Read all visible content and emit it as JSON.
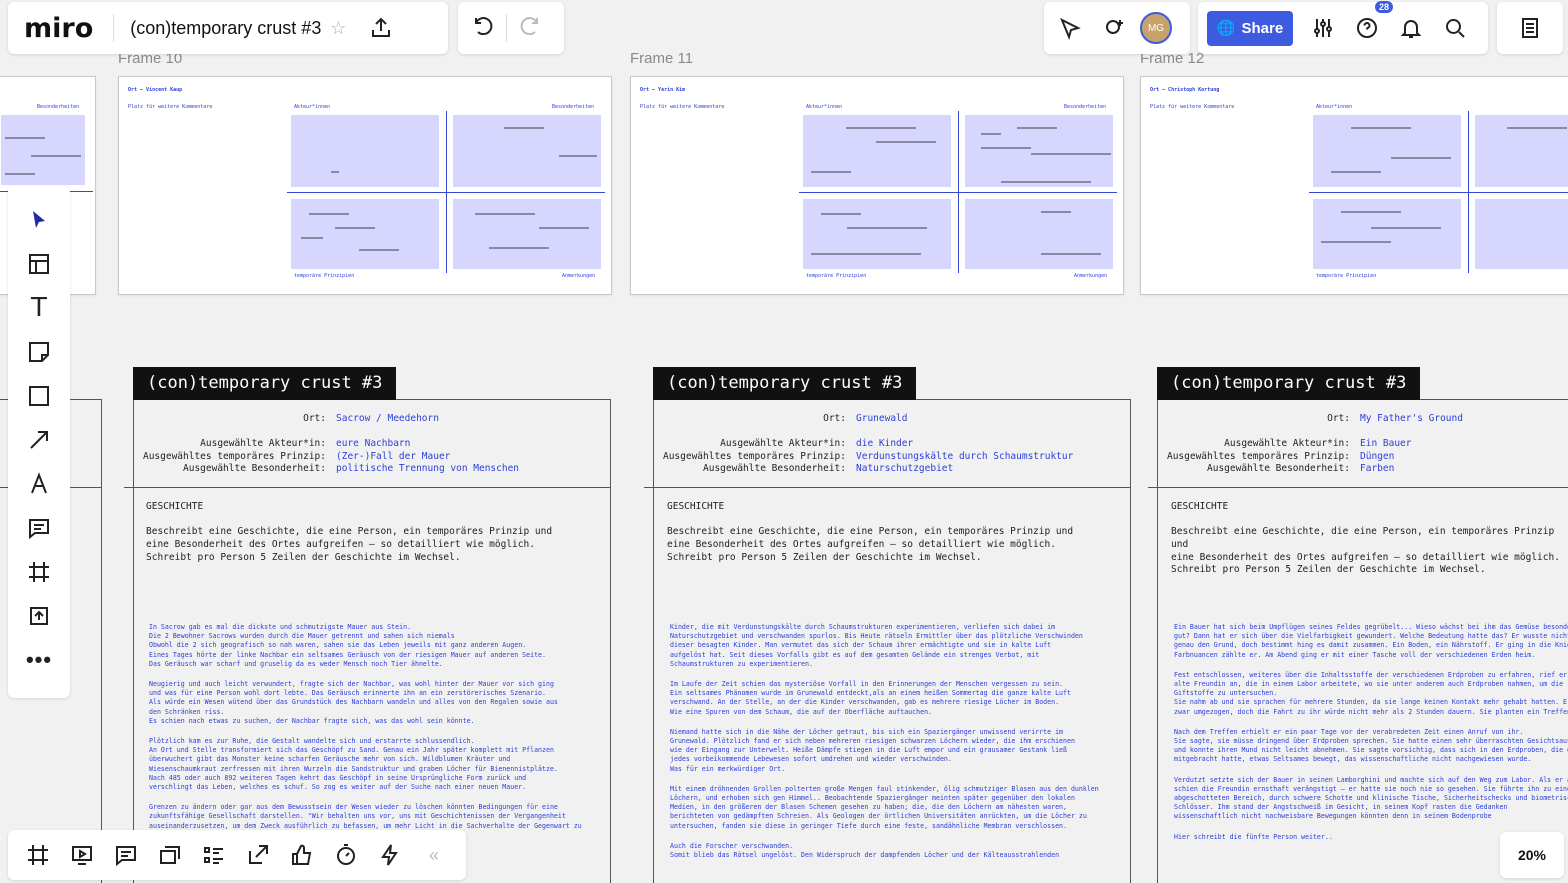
{
  "app": {
    "logo": "miro",
    "board_title": "(con)temporary crust #3",
    "share_label": "Share",
    "avatar_initials": "MG",
    "notifications_count": "28",
    "zoom": "20%",
    "accent": "#3c5be0"
  },
  "frames": [
    {
      "label": "Frame 10",
      "ort": "Ort – Vincent Kaup",
      "kommentare": "Platz für weitere Kommentare",
      "akteure": "Akteur*innen",
      "besonderheiten": "Besonderheiten",
      "prinzipien": "temporäre Prinzipien",
      "anmerkungen": "Anmerkungen"
    },
    {
      "label": "Frame 11",
      "ort": "Ort – Yerin Kim",
      "kommentare": "Platz für weitere Kommentare",
      "akteure": "Akteur*innen",
      "besonderheiten": "Besonderheiten",
      "prinzipien": "temporäre Prinzipien",
      "anmerkungen": "Anmerkungen"
    },
    {
      "label": "Frame 12",
      "ort": "Ort – Christoph Kortung",
      "kommentare": "Platz für weitere Kommentare",
      "akteure": "Akteur*innen",
      "besonderheiten": "Besonderheiten",
      "prinzipien": "temporäre Prinzipien",
      "anmerkungen": ""
    }
  ],
  "left_partial_frame": {
    "besonderheiten": "Besonderheiten"
  },
  "cards": [
    {
      "tag": "(con)temporary crust #3",
      "k_ort": "Ort:",
      "v_ort": "Sacrow / Meedehorn",
      "k_akteur": "Ausgewählte Akteur*in:",
      "v_akteur": "eure Nachbarn",
      "k_prinzip": "Ausgewähltes temporäres Prinzip:",
      "v_prinzip": "(Zer-)Fall der Mauer",
      "k_besonder": "Ausgewählte Besonderheit:",
      "v_besonder": "politische Trennung von Menschen",
      "geschichte": "GESCHICHTE",
      "instruction": "Beschreibt eine Geschichte, die eine Person, ein temporäres Prinzip und\neine Besonderheit des Ortes aufgreifen – so detailliert wie möglich.\nSchreibt pro Person 5 Zeilen der Geschichte im Wechsel.",
      "paragraphs": [
        "In Sacrow gab es mal die dickste und schmutzigste Mauer aus Stein.\nDie 2 Bewohner Sacrows wurden durch die Mauer getrennt und sahen sich niemals\nObwohl die 2 sich geografisch so nah waren, sahen sie das Leben jeweils mit ganz anderen Augen.\nEines Tages hörte der linke Nachbar ein seltsames Geräusch von der riesigen Mauer auf anderen Seite.\nDas Geräusch war scharf und gruselig da es weder Mensch noch Tier ähnelte.",
        "Neugierig und auch leicht verwundert, fragte sich der Nachbar, was wohl hinter der Mauer vor sich ging\nund was für eine Person wohl dort lebte. Das Geräusch erinnerte ihn an ein zerstörerisches Szenario.\nAls würde ein Wesen wütend über das Grundstück des Nachbarn wandeln und alles von den Regalen sowie aus\nden Schränken riss.\nEs schien nach etwas zu suchen, der Nachbar fragte sich, was das wohl sein könnte.",
        "Plötzlich kam es zur Ruhe, die Gestalt wandelte sich und erstarrte schlussendlich.\nAn Ort und Stelle transformiert sich das Geschöpf zu Sand. Genau ein Jahr später komplett mit Pflanzen\nüberwuchert gibt das Monster keine scharfen Geräusche mehr von sich. Wildblumen Kräuter und\nWiesenschaumkraut zerfressen mit ihren Wurzeln die Sandstruktur und graben Löcher für Bienennistplätze.\nNach 485 oder auch 892 weiteren Tagen kehrt das Geschöpf in seine Ursprüngliche Form zurück und\nverschlingt das Leben, welches es schuf. So zog es weiter auf der Suche nach einer neuen Mauer.",
        "Grenzen zu ändern oder gar aus dem Bewusstsein der Wesen wieder zu löschen könnten Bedingungen für eine\nzukunftsfähige Gesellschaft darstellen. \"Wir behalten uns vor, uns mit Geschichtenissen der Vergangenheit\nauseinanderzusetzen, um dem Zweck ausführlich zu befassen, um mehr Licht in die Sachverhalte der Gegenwart zu"
      ]
    },
    {
      "tag": "(con)temporary crust #3",
      "k_ort": "Ort:",
      "v_ort": "Grunewald",
      "k_akteur": "Ausgewählte Akteur*in:",
      "v_akteur": "die Kinder",
      "k_prinzip": "Ausgewähltes temporäres Prinzip:",
      "v_prinzip": "Verdunstungskälte durch Schaumstruktur",
      "k_besonder": "Ausgewählte Besonderheit:",
      "v_besonder": "Naturschutzgebiet",
      "geschichte": "GESCHICHTE",
      "instruction": "Beschreibt eine Geschichte, die eine Person, ein temporäres Prinzip und\neine Besonderheit des Ortes aufgreifen – so detailliert wie möglich.\nSchreibt pro Person 5 Zeilen der Geschichte im Wechsel.",
      "paragraphs": [
        "Kinder, die mit Verdunstungskälte durch Schaumstrukturen experimentieren, verliefen sich dabei im\nNaturschutzgebiet und verschwanden spurlos. Bis Heute rätseln Ermittler über das plötzliche Verschwinden\ndieser besagten Kinder. Man vermutet das sich der Schaum ihrer ermächtigte und sie in kalte Luft\naufgelöst hat. Seit dieses Vorfalls gibt es auf dem gesamten Gelände ein strenges Verbot, mit\nSchaumstrukturen zu experimentieren.",
        "Im Laufe der Zeit schien das mysteriöse Vorfall in den Erinnerungen der Menschen vergessen zu sein.\nEin seltsames Phänomen wurde im Grunewald entdeckt,als an einem heißen Sommertag die ganze kalte Luft\nverschwand. An der Stelle, an der die Kinder verschwanden, gab es mehrere riesige Löcher im Boden.\nWie eine Spuren von dem Schaum, die auf der Oberfläche auftauchen.",
        "Niemand hatte sich in die Nähe der Löcher getraut, bis sich ein Spaziergänger unwissend verirrte im\nGrunewald. Plötzlich fand er sich neben mehreren riesigen schwarzen Löchern wieder, die ihm erschienen\nwie der Eingang zur Unterwelt. Heiße Dämpfe stiegen in die Luft empor und ein grausamer Gestank ließ\njedes vorbeikommende Lebewesen sofort umdrehen und wieder verschwinden.\nWas für ein merkwürdiger Ort.",
        "Mit einem dröhnenden Grollen polterten große Mengen faul stinkender, ölig schmutziger Blasen aus den dunklen\nLöchern, und erhoben sich gen Himmel.. Beobachtende Spaziergänger meinten später gegenüber den lokalen\nMedien, in den größeren der Blasen Schemen gesehen zu haben; die, die den Löchern am nähesten waren,\nberichteten von gedämpften Schreien. Als Geologen der örtlichen Universitäten anrückten, um die Löcher zu\nuntersuchen, fanden sie diese in geringer Tiefe durch eine feste, sandähnliche Membran verschlossen.",
        "Auch die Forscher verschwanden.\nSomit blieb das Rätsel ungelöst. Den Widerspruch der dampfenden Löcher und der Kälteausstrahlenden"
      ]
    },
    {
      "tag": "(con)temporary crust #3",
      "k_ort": "Ort:",
      "v_ort": "My Father's Ground",
      "k_akteur": "Ausgewählte Akteur*in:",
      "v_akteur": "Ein Bauer",
      "k_prinzip": "Ausgewähltes temporäres Prinzip:",
      "v_prinzip": "Düngen",
      "k_besonder": "Ausgewählte Besonderheit:",
      "v_besonder": "Farben",
      "geschichte": "GESCHICHTE",
      "instruction": "Beschreibt eine Geschichte, die eine Person, ein temporäres Prinzip und\neine Besonderheit des Ortes aufgreifen – so detailliert wie möglich.\nSchreibt pro Person 5 Zeilen der Geschichte im Wechsel.",
      "paragraphs": [
        "Ein Bauer hat sich beim Umpflügen seines Feldes gegrübelt... Wieso wächst bei ihm das Gemüse besonders\ngut? Dann hat er sich über die Vielfarbigkeit gewundert. Welche Bedeutung hatte das? Er wusste nicht\ngenau den Grund, doch bestimmt hing es damit zusammen. Ein Boden, ein Nährstoff. Er ging in die Knie\nFarbnuancen zählte er. Am Abend ging er mit einer Tasche voll der verschiedenen Erden heim.",
        "Fest entschlossen, weiteres über die Inhaltsstoffe der verschiedenen Erdproben zu erfahren, rief er\nalte Freundin an, die in einem Labor arbeitete, wo sie unter anderem auch Erdproben nahmen, um die\nGiftstoffe zu untersuchen.\nSie nahm ab und sie sprachen für mehrere Stunden, da sie lange keinen Kontakt mehr gehabt hatten. Er\nzwar umgezogen, doch die Fahrt zu ihr würde nicht mehr als 2 Stunden dauern. Sie planten ein Treffen.",
        "Nach dem Treffen erhielt er ein paar Tage vor der verabredeten Zeit einen Anruf von ihr.\nSie sagte, sie müsse dringend über Erdproben sprechen. Sie hatte einen sehr überraschten Gesichtsausdruck\nund konnte ihren Mund nicht leicht abnehmen. Sie sagte vorsichtig, dass sich in den Erdproben, die er\nmitgebracht hatte, etwas Seltsames bewegt, das wissenschaftliche nicht nachgewiesen wurde.",
        "Verdutzt setzte sich der Bauer in seinen Lamborghini und machte sich auf den Weg zum Labor. Als er ankam\nschien die Freundin ernsthaft verängstigt – er hatte sie noch nie so gesehen. Sie führte ihn zu einem\nabgeschotteten Bereich, durch schwere Schotte und klinische Tische, Sicherheitschecks und biometrische\nSchlösser. Ihm stand der Angstschweiß im Gesicht, in seinem Kopf rasten die Gedanken\nwissenschaftlich nicht nachweisbare Bewegungen könnten denn in seinem Bodenprobe",
        "Hier schreibt die fünfte Person weiter.."
      ]
    }
  ],
  "left_tools": [
    "select-tool",
    "templates-tool",
    "text-tool",
    "sticky-note-tool",
    "shape-tool",
    "arrow-tool",
    "pen-tool",
    "comment-tool",
    "frame-tool",
    "upload-tool",
    "more-tools"
  ],
  "bottom_tools": [
    "frames-icon",
    "present-icon",
    "comments-icon",
    "cards-icon",
    "list-icon",
    "share-screen-icon",
    "reaction-icon",
    "timer-icon",
    "lightning-icon",
    "collapse-icon"
  ]
}
